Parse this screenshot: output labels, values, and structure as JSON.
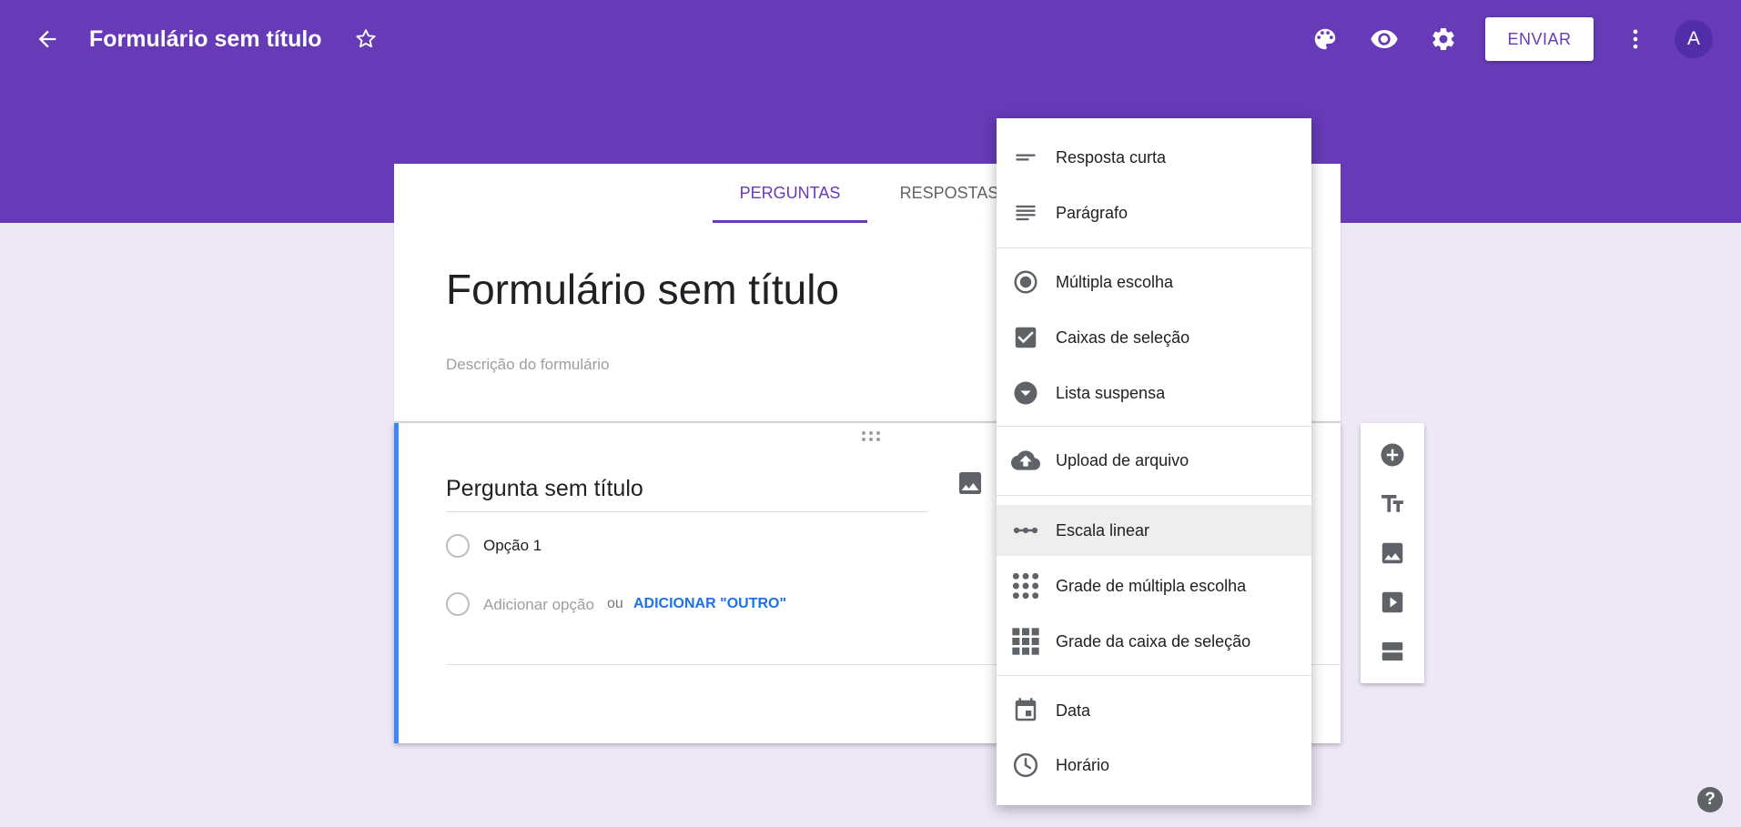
{
  "header": {
    "title": "Formulário sem título",
    "send_label": "ENVIAR",
    "avatar_initial": "A",
    "icons": [
      "back-arrow-icon",
      "star-icon",
      "palette-icon",
      "eye-icon",
      "gear-icon",
      "more-vert-icon"
    ]
  },
  "tabs": [
    {
      "label": "PERGUNTAS",
      "active": true
    },
    {
      "label": "RESPOSTAS",
      "active": false
    }
  ],
  "form": {
    "title": "Formulário sem título",
    "description_placeholder": "Descrição do formulário"
  },
  "question": {
    "title": "Pergunta sem título",
    "option1": "Opção 1",
    "add_option": "Adicionar opção",
    "or": "ou",
    "add_other": "ADICIONAR \"OUTRO\""
  },
  "menu": {
    "items": [
      {
        "label": "Resposta curta",
        "icon": "short-answer-icon"
      },
      {
        "label": "Parágrafo",
        "icon": "paragraph-icon"
      },
      {
        "label": "Múltipla escolha",
        "icon": "radio-icon"
      },
      {
        "label": "Caixas de seleção",
        "icon": "checkbox-icon"
      },
      {
        "label": "Lista suspensa",
        "icon": "dropdown-icon"
      },
      {
        "label": "Upload de arquivo",
        "icon": "cloud-upload-icon"
      },
      {
        "label": "Escala linear",
        "icon": "linear-scale-icon",
        "highlighted": true
      },
      {
        "label": "Grade de múltipla escolha",
        "icon": "dot-grid-icon"
      },
      {
        "label": "Grade da caixa de seleção",
        "icon": "square-grid-icon"
      },
      {
        "label": "Data",
        "icon": "calendar-icon"
      },
      {
        "label": "Horário",
        "icon": "clock-icon"
      }
    ]
  },
  "side_toolbar": {
    "icons": [
      "add-circle-icon",
      "title-icon",
      "image-icon",
      "video-icon",
      "section-icon"
    ]
  },
  "help": {
    "label": "?"
  },
  "colors": {
    "brand": "#673ab7",
    "background": "#ede7f6",
    "accent_blue": "#4285f4",
    "link_blue": "#1a73e8"
  }
}
